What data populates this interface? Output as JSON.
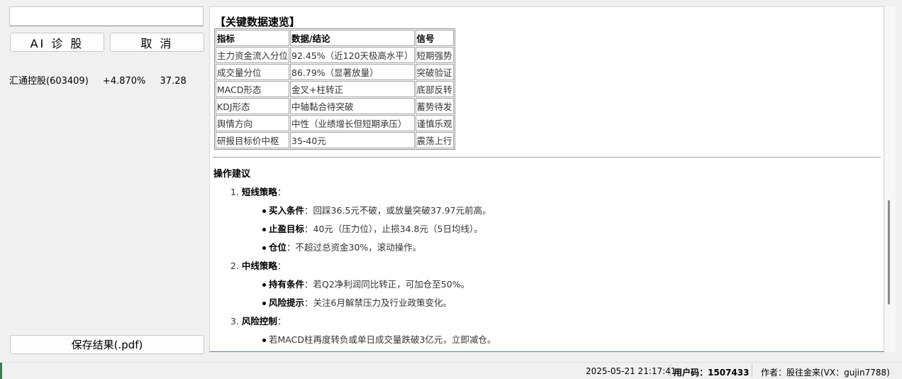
{
  "left": {
    "code_input": {
      "value": "",
      "placeholder": ""
    },
    "ai_button": "AI 诊 股",
    "cancel_button": "取 消",
    "stock": {
      "name_code": "汇通控股(603409)",
      "change": "+4.870%",
      "price": "37.28"
    },
    "save_button": "保存结果(.pdf)"
  },
  "report": {
    "section_title": "【关键数据速览】",
    "table": {
      "headers": [
        "指标",
        "数据/结论",
        "信号"
      ],
      "rows": [
        [
          "主力资金流入分位",
          "92.45%（近120天极高水平）",
          "短期强势"
        ],
        [
          "成交量分位",
          "86.79%（显著放量）",
          "突破验证"
        ],
        [
          "MACD形态",
          "金叉+柱转正",
          "底部反转"
        ],
        [
          "KDJ形态",
          "中轴黏合待突破",
          "蓄势待发"
        ],
        [
          "舆情方向",
          "中性（业绩增长但短期承压）",
          "谨慎乐观"
        ],
        [
          "研报目标价中枢",
          "35-40元",
          "震荡上行"
        ]
      ]
    },
    "advice_title": "操作建议",
    "s1": {
      "num": "1.",
      "title": "短线策略",
      "colon": "："
    },
    "s1_items": [
      {
        "label": "买入条件",
        "text": "：回踩36.5元不破，或放量突破37.97元前高。"
      },
      {
        "label": "止盈目标",
        "text": "：40元（压力位），止损34.8元（5日均线）。"
      },
      {
        "label": "仓位",
        "text": "：不超过总资金30%，滚动操作。"
      }
    ],
    "s2": {
      "num": "2.",
      "title": "中线策略",
      "colon": "："
    },
    "s2_items": [
      {
        "label": "持有条件",
        "text": "：若Q2净利润同比转正，可加仓至50%。"
      },
      {
        "label": "风险提示",
        "text": "：关注6月解禁压力及行业政策变化。"
      }
    ],
    "s3": {
      "num": "3.",
      "title": "风险控制",
      "colon": "："
    },
    "s3_items": [
      {
        "text": "若MACD柱再度转负或单日成交量跌破3亿元，立即减仓。"
      }
    ]
  },
  "status": {
    "datetime": "2025-05-21 21:17:41",
    "user_label": "用户码：",
    "user_code": "1507433",
    "author": "作者：股往金来(VX：gujin7788)"
  },
  "colors": {
    "status_grip": "#3c7a55",
    "content_border_bottom": "#4a7fb0"
  }
}
